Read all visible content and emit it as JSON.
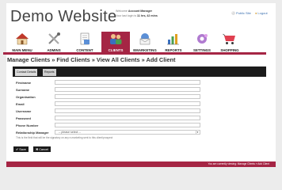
{
  "site": {
    "title": "Demo Website"
  },
  "user_info": {
    "welcome_prefix": "Welcome",
    "user_name": "Account Manager",
    "login_prefix": "Your last login is",
    "login_time": "11 hrs, 42 mins"
  },
  "top_links": {
    "public_site": "Public Site",
    "logout": "Logout"
  },
  "nav": {
    "items": [
      {
        "label": "MAIN MENU",
        "icon": "house-icon"
      },
      {
        "label": "ADMINS",
        "icon": "tools-icon"
      },
      {
        "label": "CONTENT",
        "icon": "document-icon"
      },
      {
        "label": "CLIENTS",
        "icon": "users-icon",
        "active": true
      },
      {
        "label": "EMARKETING",
        "icon": "envelope-icon"
      },
      {
        "label": "REPORTS",
        "icon": "chart-icon"
      },
      {
        "label": "SETTINGS",
        "icon": "gear-icon"
      },
      {
        "label": "SHOPPING",
        "icon": "cart-icon"
      }
    ]
  },
  "breadcrumb": "Manage Clients » Find Clients » View All Clients » Add Client",
  "tabs": {
    "contact_details": "Contact Details",
    "reports": "Reports"
  },
  "form": {
    "firstname_label": "Firstname",
    "surname_label": "Surname",
    "organisation_label": "Organisation",
    "email_label": "Email",
    "username_label": "Username",
    "password_label": "Password",
    "phone_label": "Phone Number",
    "rm_label": "Relationship Manager",
    "rm_selected": "-- please select --",
    "hint": "This is the field that will be the signatory on any e-marketing sent to this client/prospect"
  },
  "buttons": {
    "save": "Save",
    "cancel": "Cancel"
  },
  "footer": {
    "text": "You are currently viewing: Manage Clients » Add Client"
  },
  "colors": {
    "accent": "#a52544",
    "dark": "#1b1b1b",
    "link": "#3a6fb0"
  }
}
